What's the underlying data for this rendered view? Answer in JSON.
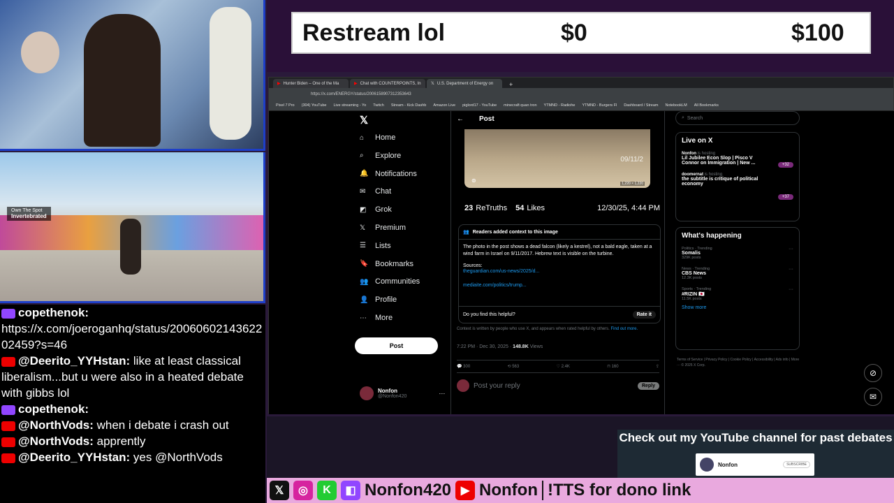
{
  "ticker": {
    "title": "Restream lol",
    "current": "$0",
    "goal": "$100"
  },
  "game_hud": {
    "quest_line1": "Own The Spot",
    "quest_line2": "Invertebrated"
  },
  "chat": [
    {
      "platform": "twitch",
      "user": "copethenok:",
      "text": ""
    },
    {
      "platform": "none",
      "user": "",
      "text": "https://x.com/joeroganhq/status/2006060214362202459?s=46"
    },
    {
      "platform": "youtube",
      "user": "@Deerito_YYHstan:",
      "text": "like at least classical liberalism...but u were also in a heated debate with gibbs lol"
    },
    {
      "platform": "twitch",
      "user": "copethenok:",
      "text": ""
    },
    {
      "platform": "youtube",
      "user": "@NorthVods:",
      "text": "when i debate i crash out"
    },
    {
      "platform": "youtube",
      "user": "@NorthVods:",
      "text": "apprently"
    },
    {
      "platform": "youtube",
      "user": "@Deerito_YYHstan:",
      "text": "yes @NorthVods"
    }
  ],
  "browser": {
    "tabs": [
      "Hunter Biden – One of the Ma",
      "Chat with COUNTERPOINTS, In",
      "U.S. Department of Energy on"
    ],
    "url": "https://x.com/ENERGY/status/2006158907312353643",
    "bookmarks": [
      "Pixel 7 Pro",
      "(304) YouTube",
      "Live streaming - Yo",
      "Twitch",
      "Stream - Kick Dashb",
      "Amazon Live",
      "piglord17 - YouTube",
      "minecraft quan tron",
      "YTMND - Radiohe",
      "YTMND - Burgers Fl",
      "Dashboard / Stream",
      "NotebookLM",
      "All Bookmarks"
    ]
  },
  "x": {
    "nav": [
      "Home",
      "Explore",
      "Notifications",
      "Chat",
      "Grok",
      "Premium",
      "Lists",
      "Bookmarks",
      "Communities",
      "Profile",
      "More"
    ],
    "post_button": "Post",
    "profile_name": "Nonfon",
    "profile_handle": "@Nonfon420",
    "post_header": "Post",
    "image_timestamp": "09/11/2",
    "image_size": "1,220 × 1,220",
    "retruths_count": "23",
    "retruths_label": "ReTruths",
    "likes_count": "54",
    "likes_label": "Likes",
    "post_date": "12/30/25, 4:44 PM",
    "community_note_title": "Readers added context to this image",
    "community_note_text": "The photo in the post shows a dead falcon (likely a kestrel), not a bald eagle, taken at a wind farm in Israel on 9/11/2017. Hebrew text is visible on the turbine.",
    "sources_label": "Sources:",
    "source1": "theguardian.com/us-news/2025/d...",
    "source2": "mediaite.com/politics/trump...",
    "helpful_question": "Do you find this helpful?",
    "rate_it": "Rate it",
    "note_footer": "Context is written by people who use X, and appears when rated helpful by others.",
    "find_out_more": "Find out more.",
    "meta_time": "7:22 PM · Dec 30, 2025 ·",
    "meta_views": "148.8K",
    "meta_views_label": "Views",
    "replies": "300",
    "reposts": "563",
    "likes": "2.4K",
    "bookmarks": "160",
    "reply_placeholder": "Post your reply",
    "reply_button": "Reply",
    "search_placeholder": "Search",
    "live_title": "Live on X",
    "live1_user": "Nonfon",
    "live1_status": "is hosting",
    "live1_title": "Lil Jubilee Econ Slop | Pisco V Connor on Immigration | New ...",
    "live1_count": "+32",
    "live2_user": "doomernat",
    "live2_status": "is hosting",
    "live2_title": "the subtitle is critique of political economy",
    "live2_count": "+37",
    "happening_title": "What's happening",
    "trends": [
      {
        "context": "Politics · Trending",
        "name": "Somalis",
        "posts": "329K posts"
      },
      {
        "context": "News · Trending",
        "name": "CBS News",
        "posts": "12.3K posts"
      },
      {
        "context": "Sports · Trending",
        "name": "#RIZIN 🇯🇵",
        "posts": "11.5K posts"
      }
    ],
    "show_more": "Show more",
    "footer": "Terms of Service | Privacy Policy | Cookie Policy | Accessibility | Ads info | More ··· © 2025 X Corp."
  },
  "yt_promo": {
    "headline": "Check out my YouTube channel for past debates",
    "channel": "Nonfon",
    "subscribe": "SUBSCRIBE"
  },
  "social": {
    "twitch": "Nonfon420",
    "youtube": "Nonfon",
    "tts": "!TTS for dono link"
  },
  "colors": {
    "x_blue": "#1d9bf0",
    "banner_purple": "#2a1038",
    "frame_blue": "#1e3fc8",
    "social_pink": "#e9a9de"
  }
}
